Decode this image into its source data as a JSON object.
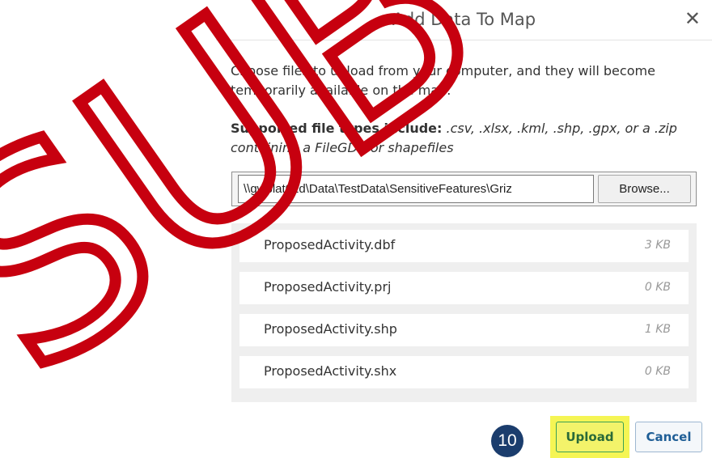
{
  "watermark": {
    "text": "SUB",
    "color": "#c7000f"
  },
  "dialog": {
    "title": "Add Data To Map",
    "close_glyph": "✕",
    "intro_text": "Choose files to upload from your computer, and they will become temporarily available on the map.",
    "supported_label": "Supported file types include:",
    "supported_types": " .csv, .xlsx, .kml, .shp, .gpx, or a .zip containing a FileGDB or shapefiles",
    "file_path": "\\\\gwblat01d\\Data\\TestData\\SensitiveFeatures\\Griz",
    "browse_label": "Browse...",
    "files": [
      {
        "name": "ProposedActivity.dbf",
        "size": "3 KB"
      },
      {
        "name": "ProposedActivity.prj",
        "size": "0 KB"
      },
      {
        "name": "ProposedActivity.shp",
        "size": "1 KB"
      },
      {
        "name": "ProposedActivity.shx",
        "size": "0 KB"
      }
    ],
    "step_number": "10",
    "upload_label": "Upload",
    "cancel_label": "Cancel"
  },
  "colors": {
    "highlight": "#f5f554",
    "badge": "#1b3d6d",
    "upload_text": "#2a6a38",
    "cancel_text": "#1f5e96"
  }
}
